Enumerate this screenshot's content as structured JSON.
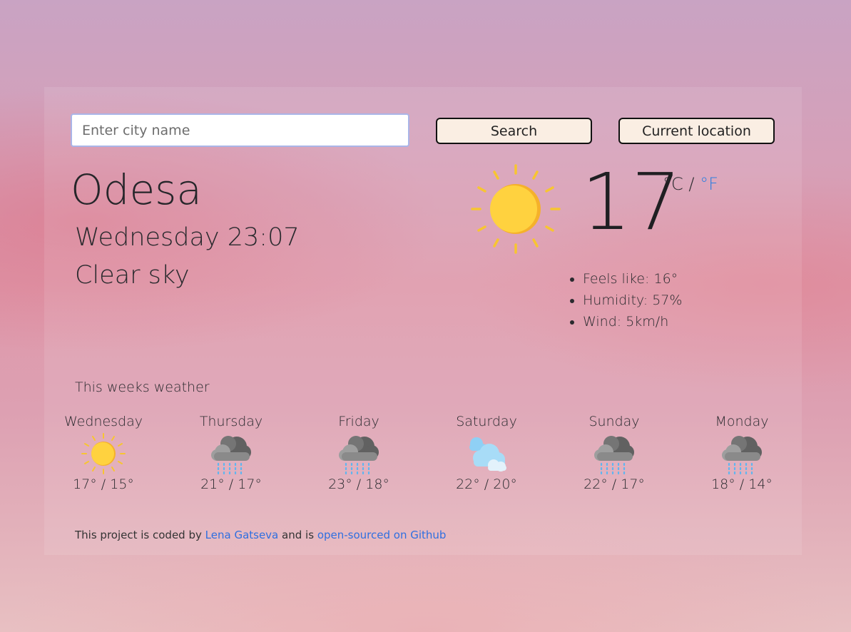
{
  "search": {
    "placeholder": "Enter city name",
    "value": ""
  },
  "buttons": {
    "search_label": "Search",
    "location_label": "Current location"
  },
  "current": {
    "city": "Odesa",
    "datetime": "Wednesday 23:07",
    "description": "Clear sky",
    "temperature": "17",
    "unit_c": "°C",
    "unit_separator": "/",
    "unit_f": "°F",
    "icon": "sun-icon",
    "details": [
      "Feels like: 16°",
      "Humidity: 57%",
      "Wind: 5km/h"
    ]
  },
  "week": {
    "title": "This weeks weather",
    "days": [
      {
        "name": "Wednesday",
        "range": "17° / 15°",
        "icon": "sun-icon"
      },
      {
        "name": "Thursday",
        "range": "21° / 17°",
        "icon": "rain-cloud-icon"
      },
      {
        "name": "Friday",
        "range": "23° / 18°",
        "icon": "rain-cloud-icon"
      },
      {
        "name": "Saturday",
        "range": "22° / 20°",
        "icon": "cloudy-icon"
      },
      {
        "name": "Sunday",
        "range": "22° / 17°",
        "icon": "rain-cloud-icon"
      },
      {
        "name": "Monday",
        "range": "18° / 14°",
        "icon": "rain-cloud-icon"
      }
    ]
  },
  "footer": {
    "prefix": "This project is coded by",
    "author": "Lena Gatseva",
    "middle": "and is",
    "link": "open-sourced on Github"
  },
  "colors": {
    "accent": "#2f7fe0",
    "button_bg": "#faeee3",
    "sun": "#ffd23f",
    "sun_ray": "#f7c531"
  }
}
